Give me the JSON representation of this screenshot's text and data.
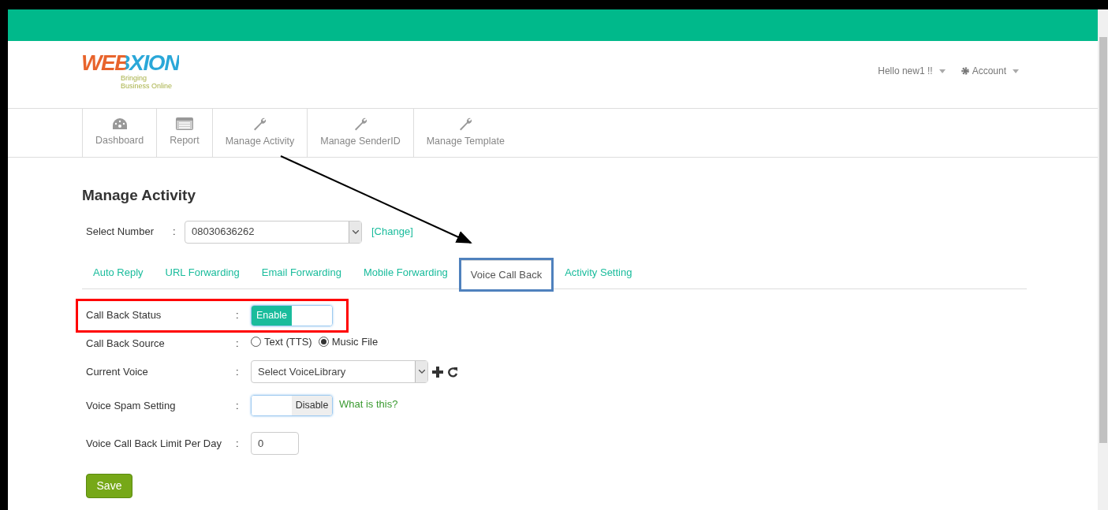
{
  "logo": {
    "name": "WEBXION",
    "tagline": [
      "Bringing",
      "Business Online"
    ]
  },
  "user_menu": [
    {
      "label": "Hello new1 !!",
      "kind": "text"
    },
    {
      "label": "Account",
      "kind": "gear"
    }
  ],
  "nav": [
    {
      "label": "Dashboard",
      "kind": "dashboard"
    },
    {
      "label": "Report",
      "kind": "report"
    },
    {
      "label": "Manage Activity",
      "kind": "wrench"
    },
    {
      "label": "Manage SenderID",
      "kind": "wrench"
    },
    {
      "label": "Manage Template",
      "kind": "wrench"
    }
  ],
  "page_title": "Manage Activity",
  "select_number": {
    "label": "Select Number",
    "colon": ":",
    "value": "08030636262",
    "link": "[Change]"
  },
  "tabs": [
    {
      "label": "Auto Reply",
      "selected": false
    },
    {
      "label": "URL Forwarding",
      "selected": false
    },
    {
      "label": "Email Forwarding",
      "selected": false
    },
    {
      "label": "Mobile Forwarding",
      "selected": false
    },
    {
      "label": "Voice Call Back",
      "selected": true
    },
    {
      "label": "Activity Setting",
      "selected": false
    }
  ],
  "form": [
    {
      "kind": "toggle",
      "label": "Call Back Status",
      "colon": ":",
      "on": true,
      "label_text": "Enable"
    },
    {
      "kind": "radio",
      "label": "Call Back Source",
      "colon": ":",
      "options": [
        {
          "label": "Text (TTS)",
          "selected": false
        },
        {
          "label": "Music File",
          "selected": true
        }
      ]
    },
    {
      "kind": "select",
      "label": "Current Voice",
      "colon": ":",
      "value": "Select VoiceLibrary"
    },
    {
      "kind": "toggle",
      "label": "Voice Spam Setting",
      "colon": ":",
      "on": false,
      "label_text": "Disable",
      "help": "What is this?"
    },
    {
      "kind": "input",
      "label": "Voice Call Back Limit Per Day",
      "colon": ":",
      "value": "0"
    }
  ],
  "save_button": "Save"
}
